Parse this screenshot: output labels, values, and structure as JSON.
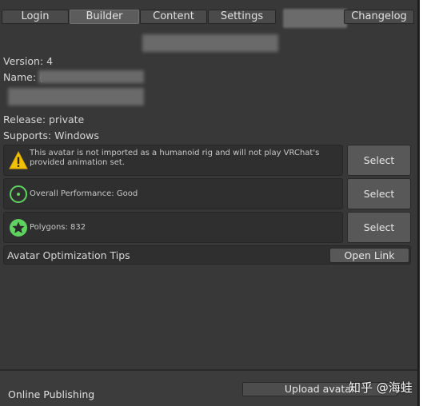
{
  "tabs": [
    {
      "label": "Login"
    },
    {
      "label": "Builder"
    },
    {
      "label": "Content"
    },
    {
      "label": "Settings"
    },
    {
      "label": ""
    },
    {
      "label": "Changelog"
    }
  ],
  "info": {
    "version": "Version: 4",
    "name_prefix": "Name: (",
    "release": "Release: private",
    "supports": "Supports: Windows"
  },
  "rows": {
    "humanoid_warning": "This avatar is not imported as a humanoid rig and will not play VRChat's provided animation set.",
    "performance": "Overall Performance: Good",
    "polygons": "Polygons: 832",
    "select_label": "Select"
  },
  "tips": {
    "label": "Avatar Optimization Tips",
    "open_link": "Open Link"
  },
  "footer": {
    "publishing_label": "Online Publishing",
    "upload_label": "Upload avatar"
  },
  "watermark": "知乎 @海蛙",
  "colors": {
    "warning": "#f2c200",
    "good": "#5fd35f",
    "background": "#383838"
  }
}
